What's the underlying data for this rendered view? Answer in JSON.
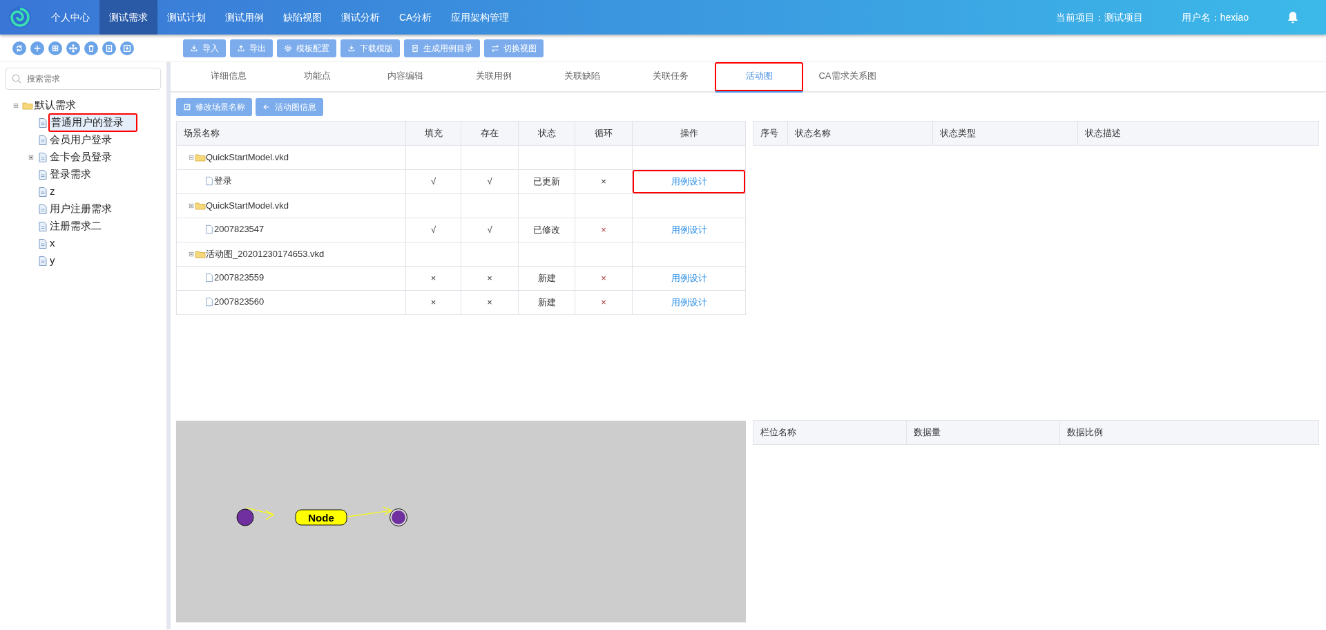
{
  "nav": {
    "items": [
      {
        "label": "个人中心",
        "selected": false
      },
      {
        "label": "测试需求",
        "selected": true
      },
      {
        "label": "测试计划",
        "selected": false
      },
      {
        "label": "测试用例",
        "selected": false
      },
      {
        "label": "缺陷视图",
        "selected": false
      },
      {
        "label": "测试分析",
        "selected": false
      },
      {
        "label": "CA分析",
        "selected": false
      },
      {
        "label": "应用架构管理",
        "selected": false
      }
    ],
    "project": "当前项目：测试项目",
    "user": "用户名：hexiao"
  },
  "tree_tools": [
    {
      "kind": "refresh"
    },
    {
      "kind": "add"
    },
    {
      "kind": "grid"
    },
    {
      "kind": "move"
    },
    {
      "kind": "delete"
    },
    {
      "kind": "export"
    },
    {
      "kind": "download"
    }
  ],
  "toolbar": [
    {
      "kind": "import",
      "label": "导入"
    },
    {
      "kind": "export",
      "label": "导出"
    },
    {
      "kind": "settings",
      "label": "模板配置"
    },
    {
      "kind": "import",
      "label": "下载模版"
    },
    {
      "kind": "doc",
      "label": "生成用例目录"
    },
    {
      "kind": "swap",
      "label": "切换视图"
    }
  ],
  "sidebar": {
    "search": {
      "placeholder": "搜索需求"
    },
    "tree": [
      {
        "label": "默认需求",
        "kind": "folder",
        "expanded": true,
        "selected": false,
        "highlighted": false,
        "children": [
          {
            "label": "普通用户的登录",
            "kind": "page",
            "selected": true,
            "highlighted": true
          },
          {
            "label": "会员用户登录",
            "kind": "page",
            "selected": false,
            "highlighted": false
          },
          {
            "label": "金卡会员登录",
            "kind": "page",
            "expanded": false,
            "selected": false,
            "highlighted": false
          },
          {
            "label": "登录需求",
            "kind": "page",
            "selected": false,
            "highlighted": false
          },
          {
            "label": "z",
            "kind": "page",
            "selected": false,
            "highlighted": false
          },
          {
            "label": "用户注册需求",
            "kind": "page",
            "selected": false,
            "highlighted": false
          },
          {
            "label": "注册需求二",
            "kind": "page",
            "selected": false,
            "highlighted": false
          },
          {
            "label": "x",
            "kind": "page",
            "selected": false,
            "highlighted": false
          },
          {
            "label": "y",
            "kind": "page",
            "selected": false,
            "highlighted": false
          }
        ]
      }
    ]
  },
  "tabs": [
    {
      "label": "详细信息",
      "selected": false,
      "highlighted": false
    },
    {
      "label": "功能点",
      "selected": false,
      "highlighted": false
    },
    {
      "label": "内容编辑",
      "selected": false,
      "highlighted": false
    },
    {
      "label": "关联用例",
      "selected": false,
      "highlighted": false
    },
    {
      "label": "关联缺陷",
      "selected": false,
      "highlighted": false
    },
    {
      "label": "关联任务",
      "selected": false,
      "highlighted": false
    },
    {
      "label": "活动图",
      "selected": true,
      "highlighted": true
    },
    {
      "label": "CA需求关系图",
      "selected": false,
      "highlighted": false
    }
  ],
  "actions": [
    {
      "kind": "edit",
      "label": "修改场景名称"
    },
    {
      "kind": "back",
      "label": "活动图信息"
    }
  ],
  "scenario_table": {
    "columns": [
      "场景名称",
      "填充",
      "存在",
      "状态",
      "循环",
      "操作"
    ],
    "rows": [
      {
        "name": "QuickStartModel.vkd",
        "expanded": true,
        "children": [
          {
            "name": "登录",
            "fill": "√",
            "exists": "√",
            "status": "已更新",
            "loop": "×",
            "action": "用例设计",
            "highlighted": true
          }
        ]
      },
      {
        "name": "QuickStartModel.vkd",
        "expanded": true,
        "children": [
          {
            "name": "2007823547",
            "fill": "√",
            "exists": "√",
            "status": "已修改",
            "loop": "×",
            "action": "用例设计",
            "highlighted": false
          }
        ]
      },
      {
        "name": "活动图_20201230174653.vkd",
        "expanded": true,
        "children": [
          {
            "name": "2007823559",
            "fill": "×",
            "exists": "×",
            "status": "新建",
            "loop": "×",
            "action": "用例设计",
            "highlighted": false
          },
          {
            "name": "2007823560",
            "fill": "×",
            "exists": "×",
            "status": "新建",
            "loop": "×",
            "action": "用例设计",
            "highlighted": false
          }
        ]
      }
    ]
  },
  "state_table": {
    "columns": [
      "序号",
      "状态名称",
      "状态类型",
      "状态描述"
    ]
  },
  "diagram": {
    "nodes": [
      {
        "kind": "start"
      },
      {
        "kind": "action",
        "label": "Node"
      },
      {
        "kind": "end"
      }
    ]
  },
  "field_table": {
    "columns": [
      "栏位名称",
      "数据量",
      "数据比例"
    ]
  }
}
